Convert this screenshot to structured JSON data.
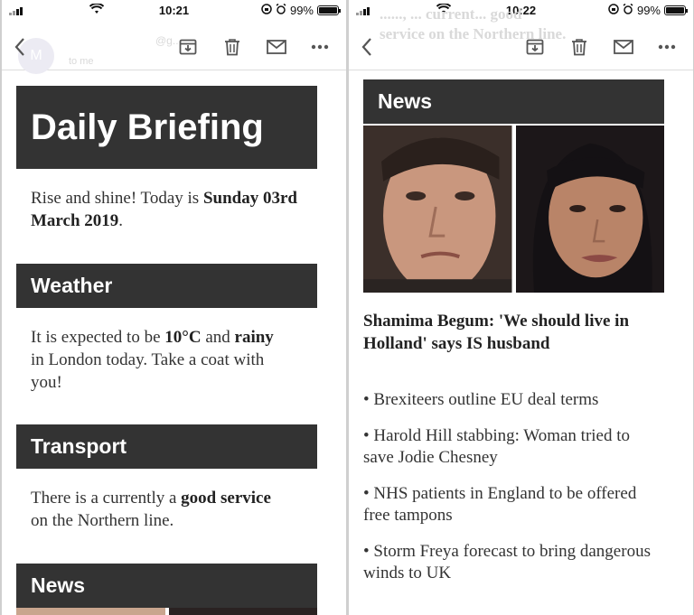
{
  "left": {
    "status": {
      "time": "10:21",
      "battery": "99%",
      "battery_level": 0.99
    },
    "ghost": {
      "avatar_letter": "M",
      "sender": "@g...",
      "label": "to me"
    },
    "title": "Daily Briefing",
    "greeting": {
      "intro": "Rise and shine! Today is ",
      "date": "Sunday 03rd March 2019",
      "end": "."
    },
    "weather": {
      "heading": "Weather",
      "p1": "It is expected to be ",
      "temp": "10°C",
      "p2": " and ",
      "condition": "rainy",
      "p3": " in London today. Take a coat with you!"
    },
    "transport": {
      "heading": "Transport",
      "p1": "There is a currently a ",
      "status": "good service",
      "p2": " on the Northern line."
    },
    "news_heading": "News"
  },
  "right": {
    "status": {
      "time": "10:22",
      "battery": "99%",
      "battery_level": 0.99
    },
    "ghost": {
      "line1": "......, ...  current... good",
      "line2": "service on the Northern line."
    },
    "news_heading": "News",
    "headline": "Shamima Begum: 'We should live in Holland' says IS husband",
    "items": [
      "• Brexiteers outline EU deal terms",
      "• Harold Hill stabbing: Woman tried to save Jodie Chesney",
      "• NHS patients in England to be offered free tampons",
      "• Storm Freya forecast to bring dangerous winds to UK"
    ]
  },
  "icons": {
    "back": "back-arrow-icon",
    "archive": "archive-icon",
    "delete": "trash-icon",
    "mail": "mail-icon",
    "more": "more-icon"
  },
  "colors": {
    "header_bg": "#333333",
    "header_text": "#ffffff",
    "body_text": "#333333"
  }
}
